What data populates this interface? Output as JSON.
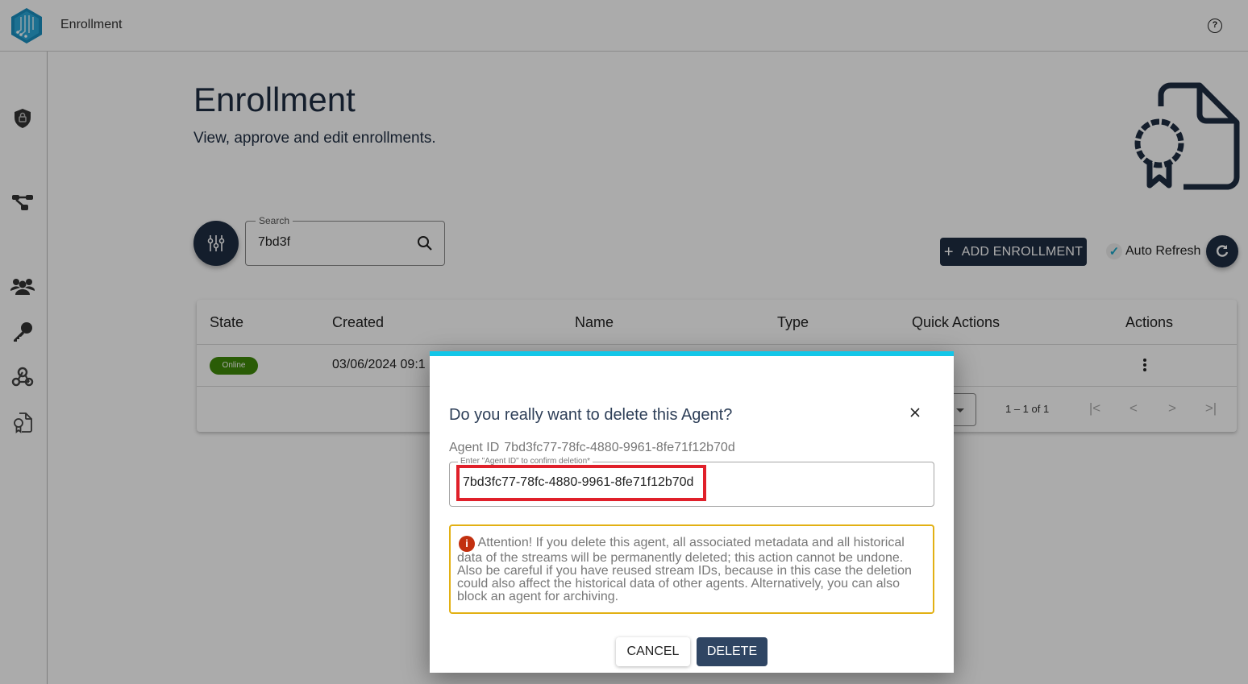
{
  "header": {
    "app_title": "Enrollment",
    "help_icon": "help-circle-icon"
  },
  "sidebar": {
    "items": [
      {
        "name": "security",
        "icon": "shield-lock-icon"
      },
      {
        "name": "topology",
        "icon": "flow-graph-icon"
      },
      {
        "name": "users",
        "icon": "group-icon"
      },
      {
        "name": "keys",
        "icon": "key-icon"
      },
      {
        "name": "webhooks",
        "icon": "webhook-icon"
      },
      {
        "name": "enrollment",
        "icon": "certificate-file-icon"
      }
    ]
  },
  "page": {
    "title": "Enrollment",
    "subtitle": "View, approve and edit enrollments."
  },
  "toolbar": {
    "search_label": "Search",
    "search_value": "7bd3f",
    "add_label": "ADD ENROLLMENT",
    "auto_refresh_label": "Auto Refresh",
    "auto_refresh_checked": true
  },
  "table": {
    "columns": [
      "State",
      "Created",
      "Name",
      "Type",
      "Quick Actions",
      "Actions"
    ],
    "rows": [
      {
        "state": "Online",
        "created": "03/06/2024 09:1",
        "name": "",
        "type": "",
        "quick_actions": ""
      }
    ],
    "pagination": {
      "range": "1 – 1 of 1",
      "first": "|<",
      "prev": "<",
      "next": ">",
      "last": ">|"
    }
  },
  "dialog": {
    "title": "Do you really want to delete this Agent?",
    "agent_id_label": "Agent ID",
    "agent_id_value": "7bd3fc77-78fc-4880-9961-8fe71f12b70d",
    "confirm_label": "Enter \"Agent ID\" to confirm deletion*",
    "confirm_value": "7bd3fc77-78fc-4880-9961-8fe71f12b70d",
    "warning_icon": "i",
    "warning_text": "Attention! If you delete this agent, all associated metadata and all historical data of the streams will be permanently deleted; this action cannot be undone. Also be careful if you have reused stream IDs, because in this case the deletion could also affect the historical data of other agents. Alternatively, you can also block an agent for archiving.",
    "cancel_label": "CANCEL",
    "delete_label": "DELETE"
  },
  "colors": {
    "primary": "#1f2d42",
    "accent": "#13c6e8",
    "online": "#3f8a0a",
    "warning_border": "#e2b013",
    "danger_icon": "#c2300f",
    "highlight": "#e0202a"
  }
}
